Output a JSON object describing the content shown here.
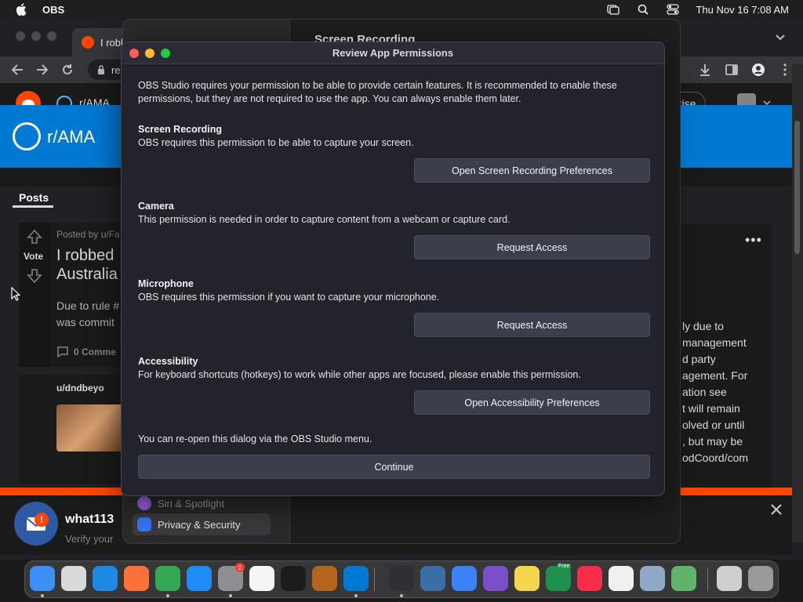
{
  "menubar": {
    "app_name": "OBS",
    "datetime": "Thu Nov 16  7:08 AM",
    "icons": [
      "apple-icon",
      "screen-mirroring-icon",
      "spotlight-search-icon",
      "control-center-icon"
    ]
  },
  "browser": {
    "tab_title": "I robb",
    "url_fragment": "re",
    "subreddit_nav": "r/AMA",
    "advertise_label": "rtise",
    "banner_title": "r/AMA",
    "posts_tab": "Posts",
    "post": {
      "posted_by": "Posted by u/Fa",
      "vote_label": "Vote",
      "title_line1": "I robbed",
      "title_line2": "Australia",
      "body_line1": "Due to rule #",
      "body_line2": "was commit",
      "comments": "0 Comme"
    },
    "post2_user": "u/dndbeyo",
    "sidebar_lines": [
      "ly due to",
      "management",
      "d party",
      "agement. For",
      "ation see",
      "t will remain",
      "olved or until",
      ", but may be",
      "",
      "odCoord/com"
    ],
    "notification": {
      "title": "what113",
      "subtitle": "Verify your",
      "badge": "!"
    }
  },
  "settings": {
    "title": "Screen Recording",
    "sidebar_items": [
      {
        "label": "Siri & Spotlight",
        "icon": "siri-icon"
      },
      {
        "label": "Privacy & Security",
        "icon": "hand-icon"
      }
    ]
  },
  "dialog": {
    "title": "Review App Permissions",
    "intro": "OBS Studio requires your permission to be able to provide certain features. It is recommended to enable these permissions, but they are not required to use the app. You can always enable them later.",
    "permissions": [
      {
        "name": "Screen Recording",
        "description": "OBS requires this permission to be able to capture your screen.",
        "button": "Open Screen Recording Preferences"
      },
      {
        "name": "Camera",
        "description": "This permission is needed in order to capture content from a webcam or capture card.",
        "button": "Request Access"
      },
      {
        "name": "Microphone",
        "description": "OBS requires this permission if you want to capture your microphone.",
        "button": "Request Access"
      },
      {
        "name": "Accessibility",
        "description": "For keyboard shortcuts (hotkeys) to work while other apps are focused, please enable this permission.",
        "button": "Open Accessibility Preferences"
      }
    ],
    "footer": "You can re-open this dialog via the OBS Studio menu.",
    "continue_label": "Continue"
  },
  "dock": {
    "items": [
      {
        "name": "finder-icon",
        "color": "#3d8ff5"
      },
      {
        "name": "launchpad-icon",
        "color": "#d9d9d9"
      },
      {
        "name": "safari-icon",
        "color": "#1e88e5"
      },
      {
        "name": "firefox-icon",
        "color": "#ff7139"
      },
      {
        "name": "chrome-icon",
        "color": "#34a853"
      },
      {
        "name": "app-store-icon",
        "color": "#1d8cf8"
      },
      {
        "name": "system-settings-icon",
        "color": "#8e8e93"
      },
      {
        "name": "textedit-icon",
        "color": "#f5f5f5"
      },
      {
        "name": "terminal-icon",
        "color": "#1c1c1c"
      },
      {
        "name": "instruments-icon",
        "color": "#b5651d"
      },
      {
        "name": "vscode-icon",
        "color": "#0078d4"
      },
      {
        "name": "obs-icon",
        "color": "#2f2f35"
      },
      {
        "name": "quicktime-icon",
        "color": "#3a6ea5"
      },
      {
        "name": "mail-icon",
        "color": "#3b82f6"
      },
      {
        "name": "visual-studio-icon",
        "color": "#7b4fc9"
      },
      {
        "name": "notes-icon",
        "color": "#f7d54a"
      },
      {
        "name": "excel-icon",
        "color": "#1f8f4e"
      },
      {
        "name": "music-icon",
        "color": "#fa2d48"
      },
      {
        "name": "clock-icon",
        "color": "#f0f0f0"
      },
      {
        "name": "screen-sharing-icon",
        "color": "#8fa8c8"
      },
      {
        "name": "maps-icon",
        "color": "#5fb36b"
      },
      {
        "name": "documents-folder-icon",
        "color": "#cfcfcf"
      },
      {
        "name": "trash-icon",
        "color": "#9a9a9a"
      }
    ],
    "settings_badge": "2",
    "excel_badge": "Free"
  }
}
